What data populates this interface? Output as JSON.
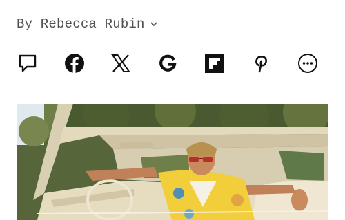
{
  "byline": {
    "text": "By Rebecca Rubin",
    "chevron_icon": "chevron-down-icon"
  },
  "share": {
    "buttons": [
      {
        "id": "comment",
        "icon": "comment-icon"
      },
      {
        "id": "facebook",
        "icon": "facebook-icon"
      },
      {
        "id": "x",
        "icon": "x-icon"
      },
      {
        "id": "google",
        "icon": "google-icon"
      },
      {
        "id": "flipboard",
        "icon": "flipboard-icon"
      },
      {
        "id": "pinterest",
        "icon": "pinterest-icon"
      },
      {
        "id": "more",
        "icon": "more-options-icon"
      }
    ]
  },
  "hero_image": {
    "alt": "Man in sunglasses and a yellow floral shirt sitting in a convertible",
    "colors": {
      "foliage": "#5c6b3a",
      "car_cream": "#e6dcc0",
      "shirt": "#f2cf3a",
      "sky": "#dfe9ee"
    }
  }
}
